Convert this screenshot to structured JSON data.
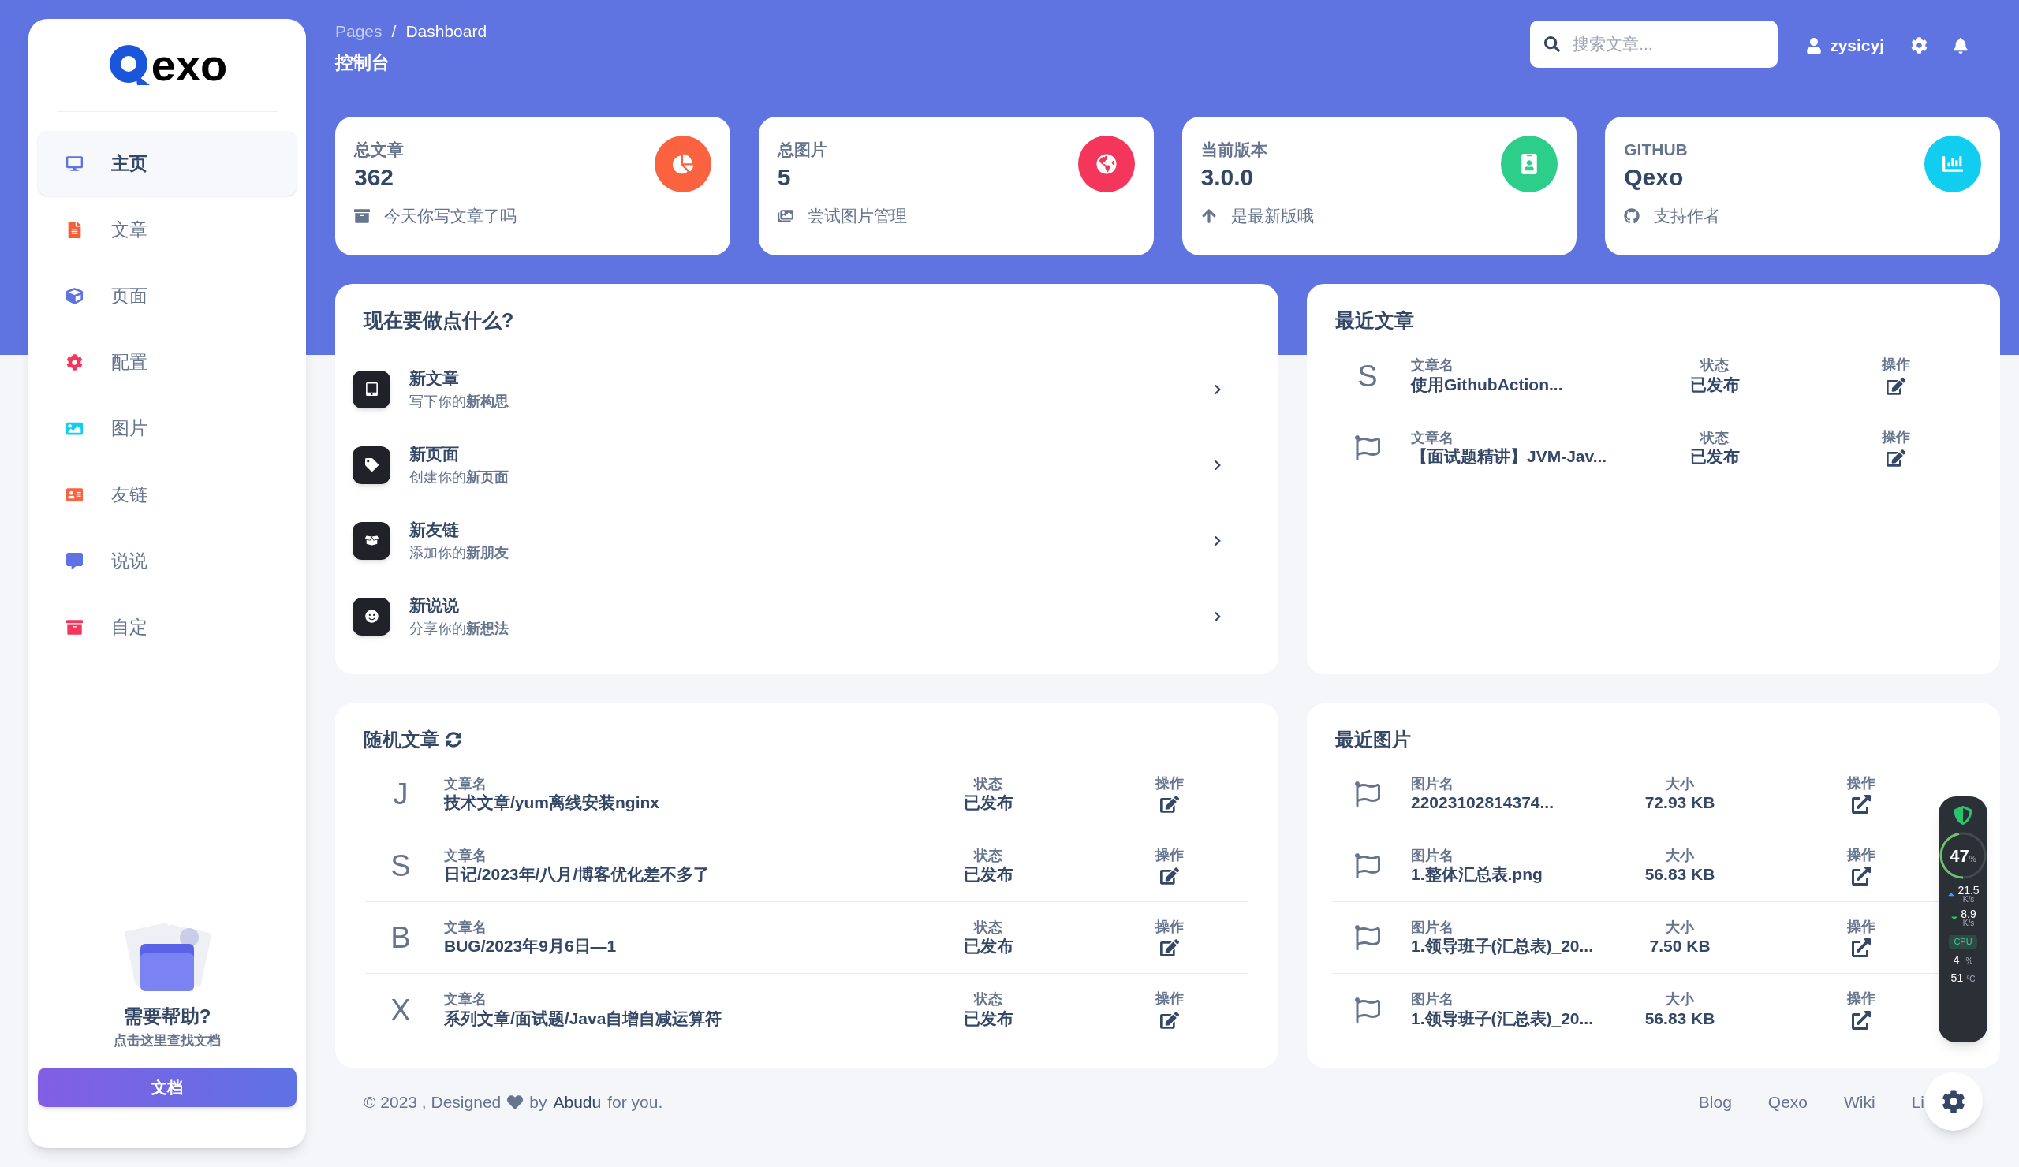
{
  "sidebar": {
    "logo_text": "exo",
    "items": [
      {
        "label": "主页",
        "kind": "monitor",
        "color": "#5e72e4",
        "selected": true
      },
      {
        "label": "文章",
        "kind": "doc",
        "color": "#f5603c",
        "selected": false
      },
      {
        "label": "页面",
        "kind": "cube",
        "color": "#5e72e4",
        "selected": false
      },
      {
        "label": "配置",
        "kind": "gear",
        "color": "#f5365c",
        "selected": false
      },
      {
        "label": "图片",
        "kind": "image",
        "color": "#11cdef",
        "selected": false
      },
      {
        "label": "友链",
        "kind": "card",
        "color": "#fb6340",
        "selected": false
      },
      {
        "label": "说说",
        "kind": "chat",
        "color": "#5e72e4",
        "selected": false
      },
      {
        "label": "自定",
        "kind": "box",
        "color": "#f5365c",
        "selected": false
      }
    ],
    "help": {
      "title": "需要帮助?",
      "subtitle": "点击这里查找文档",
      "button": "文档"
    }
  },
  "header": {
    "breadcrumb": [
      "Pages",
      "/",
      "Dashboard"
    ],
    "title": "控制台",
    "search": {
      "placeholder": "搜索文章..."
    },
    "user": "zysicyj"
  },
  "stat_cards": [
    {
      "label": "总文章",
      "value": "362",
      "footer": {
        "text": "今天你写文章了吗",
        "kind": "archive"
      },
      "kind": "pie",
      "color": "#fb6340"
    },
    {
      "label": "总图片",
      "value": "5",
      "footer": {
        "text": "尝试图片管理",
        "kind": "images"
      },
      "kind": "globe",
      "color": "#f5365c"
    },
    {
      "label": "当前版本",
      "value": "3.0.0",
      "footer": {
        "text": "是最新版哦",
        "kind": "arrow"
      },
      "kind": "badge",
      "color": "#2dce89"
    },
    {
      "label": "GITHUB",
      "value": "Qexo",
      "footer": {
        "text": "支持作者",
        "kind": "github"
      },
      "kind": "bars",
      "color": "#11cdef"
    }
  ],
  "actions": {
    "title": "现在要做点什么?",
    "items": [
      {
        "title": "新文章",
        "subtitle": "写下你的**新构思**",
        "kind": "tablet"
      },
      {
        "title": "新页面",
        "subtitle": "创建你的**新页面**",
        "kind": "tag"
      },
      {
        "title": "新友链",
        "subtitle": "添加你的**新朋友**",
        "kind": "box"
      },
      {
        "title": "新说说",
        "subtitle": "分享你的**新想法**",
        "kind": "smile"
      }
    ]
  },
  "recent_posts": {
    "title": "最近文章",
    "rows": [
      {
        "kind": "letter",
        "letter": "S",
        "name_label": "文章名",
        "name": "使用GithubAction...",
        "status_label": "状态",
        "status": "已发布",
        "action_label": "操作"
      },
      {
        "kind": "flag",
        "name_label": "文章名",
        "name": "【面试题精讲】JVM-Jav...",
        "status_label": "状态",
        "status": "已发布",
        "action_label": "操作"
      }
    ]
  },
  "random_posts": {
    "title": "随机文章",
    "rows": [
      {
        "kind": "letter",
        "letter": "J",
        "name_label": "文章名",
        "name": "技术文章/yum离线安装nginx",
        "status_label": "状态",
        "status": "已发布",
        "action_label": "操作"
      },
      {
        "kind": "letter",
        "letter": "S",
        "name_label": "文章名",
        "name": "日记/2023年/八月/博客优化差不多了",
        "status_label": "状态",
        "status": "已发布",
        "action_label": "操作"
      },
      {
        "kind": "letter",
        "letter": "B",
        "name_label": "文章名",
        "name": "BUG/2023年9月6日—1",
        "status_label": "状态",
        "status": "已发布",
        "action_label": "操作"
      },
      {
        "kind": "letter",
        "letter": "X",
        "name_label": "文章名",
        "name": "系列文章/面试题/Java自增自减运算符",
        "status_label": "状态",
        "status": "已发布",
        "action_label": "操作"
      }
    ]
  },
  "recent_images": {
    "title": "最近图片",
    "rows": [
      {
        "kind": "flag",
        "name_label": "图片名",
        "name": "22023102814374...",
        "size_label": "大小",
        "size": "72.93 KB",
        "action_label": "操作"
      },
      {
        "kind": "flag",
        "name_label": "图片名",
        "name": "1.整体汇总表.png",
        "size_label": "大小",
        "size": "56.83 KB",
        "action_label": "操作"
      },
      {
        "kind": "flag",
        "name_label": "图片名",
        "name": "1.领导班子(汇总表)_20...",
        "size_label": "大小",
        "size": "7.50 KB",
        "action_label": "操作"
      },
      {
        "kind": "flag",
        "name_label": "图片名",
        "name": "1.领导班子(汇总表)_20...",
        "size_label": "大小",
        "size": "56.83 KB",
        "action_label": "操作"
      }
    ]
  },
  "footer": {
    "before": "© 2023 , Designed",
    "by": "by",
    "author": "Abudu",
    "after": "for you.",
    "links": [
      "Blog",
      "Qexo",
      "Wiki",
      "Li"
    ]
  },
  "monitor": {
    "percent": "47",
    "percent_unit": "%",
    "level": 0.47,
    "up": "21.5",
    "up_unit": "K/s",
    "down": "8.9",
    "down_unit": "K/s",
    "cpu_label": "CPU",
    "cpu": "4",
    "cpu_unit": "%",
    "temp": "51",
    "temp_unit": "°C"
  }
}
